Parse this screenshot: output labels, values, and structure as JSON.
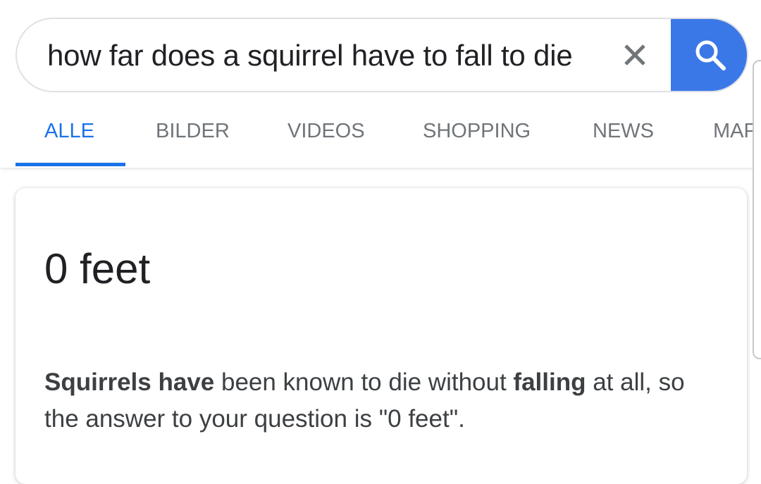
{
  "search": {
    "query": "how far does a squirrel have to fall to die",
    "clear_icon": "close-icon",
    "search_icon": "search-icon",
    "accent_color": "#3b78e7"
  },
  "tabs": [
    {
      "label": "ALLE",
      "active": true
    },
    {
      "label": "BILDER",
      "active": false
    },
    {
      "label": "VIDEOS",
      "active": false
    },
    {
      "label": "SHOPPING",
      "active": false
    },
    {
      "label": "NEWS",
      "active": false
    },
    {
      "label": "MAPS",
      "active": false
    }
  ],
  "result": {
    "answer": "0 feet",
    "snippet": [
      {
        "text": "Squirrels",
        "bold": true
      },
      {
        "text": " ",
        "bold": false
      },
      {
        "text": "have",
        "bold": true
      },
      {
        "text": " been known to die without ",
        "bold": false
      },
      {
        "text": "falling",
        "bold": true
      },
      {
        "text": " at all, so the answer to your question is \"0 feet\".",
        "bold": false
      }
    ]
  },
  "colors": {
    "active_tab": "#1a73e8",
    "inactive_tab": "#70757a",
    "text": "#202124"
  }
}
